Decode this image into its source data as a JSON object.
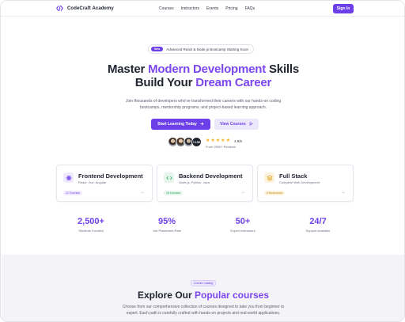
{
  "colors": {
    "accent": "#6d3fe8",
    "accent_text": "#7b46ee",
    "star": "#f6b21b"
  },
  "nav": {
    "brand": "CodeCraft Academy",
    "brand_icon": "code-brackets-icon",
    "links": [
      "Courses",
      "Instructors",
      "Events",
      "Pricing",
      "FAQs"
    ],
    "signin": "Sign In"
  },
  "hero": {
    "badge": "New",
    "announcement": "Advanced React & Node.js Bootcamp Starting Soon",
    "title_line1_pre": "Master ",
    "title_line1_accent": "Modern Development",
    "title_line1_post": " Skills",
    "title_line2_pre": "Build Your ",
    "title_line2_accent": "Dream Career",
    "subtitle": "Join thousands of developers who've transformed their careers with our hands-on coding bootcamps, mentorship programs, and project-based learning approach.",
    "primary_button": "Start Learning Today",
    "secondary_button": "View Courses",
    "avatars_more": "+2.5K",
    "rating_stars": 5,
    "rating_score": "4.9/5",
    "reviews": "From 2500+ Reviews"
  },
  "cards": [
    {
      "title": "Frontend Development",
      "meta": "React, Vue, Angular",
      "tag": "12 Courses",
      "icon": "frontend-atom-icon"
    },
    {
      "title": "Backend Development",
      "meta": "Node.js, Python, Java",
      "tag": "15 Courses",
      "icon": "backend-server-icon"
    },
    {
      "title": "Full Stack",
      "meta": "Complete Web Development",
      "tag": "8 Bootcamps",
      "icon": "full-stack-layers-icon"
    }
  ],
  "stats": [
    {
      "num": "2,500+",
      "label": "Students Enrolled"
    },
    {
      "num": "95%",
      "label": "Job Placement Rate"
    },
    {
      "num": "50+",
      "label": "Expert Instructors"
    },
    {
      "num": "24/7",
      "label": "Support Available"
    }
  ],
  "catalog": {
    "badge": "Course Catalog",
    "title_pre": "Explore Our ",
    "title_accent": "Popular courses",
    "subtitle": "Choose from our comprehensive collection of courses designed to take you from beginner to expert. Each path is carefully crafted with hands-on projects and real-world applications."
  }
}
